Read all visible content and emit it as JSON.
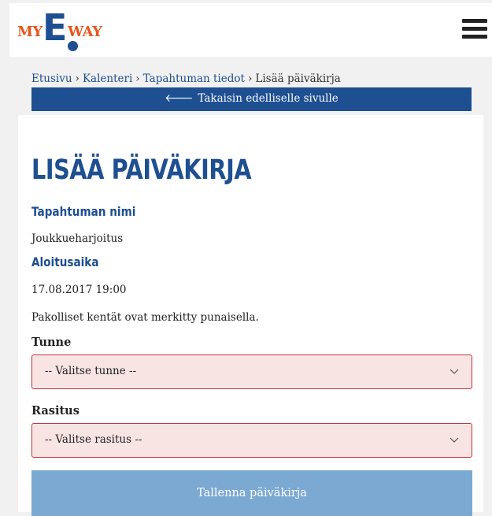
{
  "header": {
    "logo": {
      "my": "MY",
      "e": "E",
      "way": "WAY"
    },
    "menu_icon": "hamburger-menu-icon"
  },
  "breadcrumb": {
    "items": [
      "Etusivu",
      "Kalenteri",
      "Tapahtuman tiedot"
    ],
    "current": "Lisää päiväkirja",
    "separator": "›"
  },
  "back_bar": {
    "label": "Takaisin edelliselle sivulle",
    "icon": "arrow-left-icon"
  },
  "main": {
    "title": "LISÄÄ PÄIVÄKIRJA",
    "event_name_label": "Tapahtuman nimi",
    "event_name_value": "Joukkueharjoitus",
    "start_time_label": "Aloitusaika",
    "start_time_value": "17.08.2017 19:00",
    "required_note": "Pakolliset kentät ovat merkitty punaisella.",
    "feeling": {
      "label": "Tunne",
      "selected": "-- Valitse tunne --"
    },
    "strain": {
      "label": "Rasitus",
      "selected": "-- Valitse rasitus --"
    },
    "save_label": "Tallenna päiväkirja"
  },
  "colors": {
    "brand_blue": "#1e4f91",
    "brand_orange": "#e8561e",
    "required_bg": "#f9e4e4",
    "required_border": "#c0363a",
    "save_button": "#7ba9d2"
  }
}
